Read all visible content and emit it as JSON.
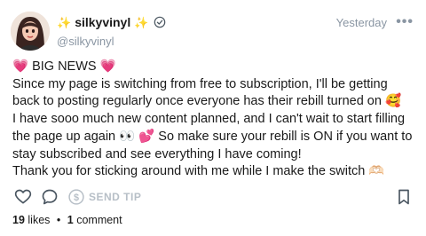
{
  "post": {
    "display_name": "silkyvinyl",
    "handle": "@silkyvinyl",
    "timestamp": "Yesterday",
    "more_label": "•••",
    "lines": [
      "💗 BIG NEWS 💗",
      "Since my page is switching from free to subscription, I'll be getting back to posting regularly once everyone has their rebill turned on 🥰",
      "I have sooo much new content planned, and I can't wait to start filling the page up again 👀 💕 So make sure your rebill is ON if you want to stay subscribed and see everything I have coming!",
      "Thank you for sticking around with me while I make the switch 🫶🏻"
    ]
  },
  "actions": {
    "tip_label": "SEND TIP"
  },
  "stats": {
    "likes_count": "19",
    "likes_label": "likes",
    "separator": "•",
    "comments_count": "1",
    "comments_label": "comment"
  },
  "colors": {
    "muted": "#8a96a3",
    "icon": "#4a5661",
    "sparkle": "#f2b824",
    "text": "#1a1a1a"
  }
}
